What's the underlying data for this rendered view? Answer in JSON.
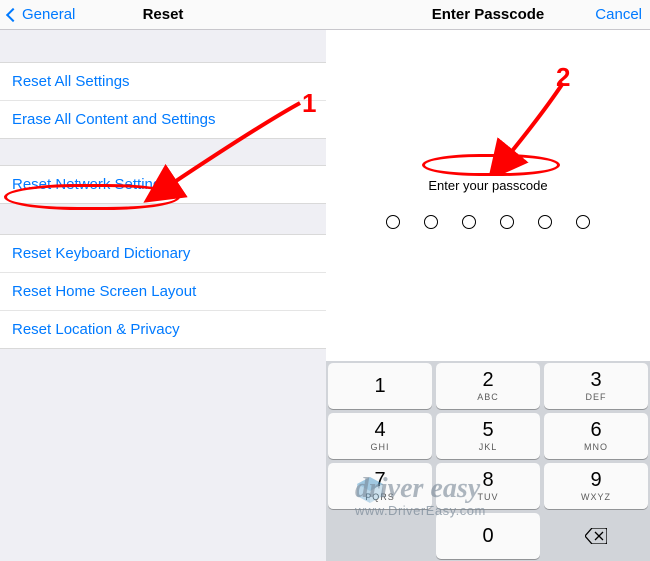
{
  "left": {
    "back_label": "General",
    "title": "Reset",
    "group1": [
      {
        "label": "Reset All Settings"
      },
      {
        "label": "Erase All Content and Settings"
      }
    ],
    "group2": [
      {
        "label": "Reset Network Settings"
      }
    ],
    "group3": [
      {
        "label": "Reset Keyboard Dictionary"
      },
      {
        "label": "Reset Home Screen Layout"
      },
      {
        "label": "Reset Location & Privacy"
      }
    ]
  },
  "right": {
    "title": "Enter Passcode",
    "cancel": "Cancel",
    "prompt": "Enter your passcode",
    "keypad": [
      [
        {
          "n": "1",
          "s": ""
        },
        {
          "n": "2",
          "s": "ABC"
        },
        {
          "n": "3",
          "s": "DEF"
        }
      ],
      [
        {
          "n": "4",
          "s": "GHI"
        },
        {
          "n": "5",
          "s": "JKL"
        },
        {
          "n": "6",
          "s": "MNO"
        }
      ],
      [
        {
          "n": "7",
          "s": "PQRS"
        },
        {
          "n": "8",
          "s": "TUV"
        },
        {
          "n": "9",
          "s": "WXYZ"
        }
      ],
      [
        {
          "blank": true
        },
        {
          "n": "0",
          "s": ""
        },
        {
          "backspace": true
        }
      ]
    ]
  },
  "annotations": {
    "step1": "1",
    "step2": "2"
  },
  "watermark": {
    "brand": "driver easy",
    "url": "www.DriverEasy.com"
  }
}
